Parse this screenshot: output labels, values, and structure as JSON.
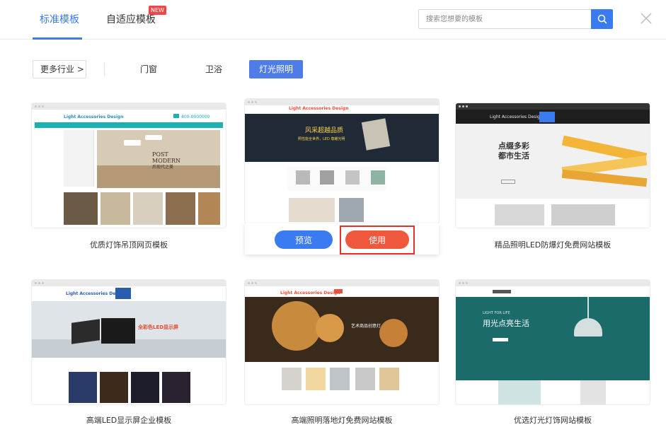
{
  "tabs": {
    "standard": "标准模板",
    "adaptive": "自适应模板",
    "new_badge": "NEW"
  },
  "search": {
    "placeholder": "搜索您想要的模板"
  },
  "filters": {
    "more": "更多行业 >",
    "doors": "门窗",
    "bath": "卫浴",
    "lighting": "灯光照明"
  },
  "cards": [
    {
      "title": "优质灯饰吊顶网页模板",
      "brand": "Light Accessories Design",
      "phone": "400-0000000",
      "headline": "POST MODERN",
      "sub": "后现代之美"
    },
    {
      "title": "",
      "brand": "Light Accessories Design",
      "headline": "风采超越品质",
      "sub": "照性能全世界，LED 尊耀光明",
      "preview": "预览",
      "use": "使用"
    },
    {
      "title": "精品照明LED防爆灯免费网站模板",
      "brand": "Light Accessories Design",
      "headline": "点缀多彩",
      "sub": "都市生活"
    },
    {
      "title": "高端LED显示屏企业模板",
      "brand": "Light Accessories Design",
      "headline": "全彩色LED显示屏"
    },
    {
      "title": "高端照明落地灯免费网站模板",
      "brand": "Light Accessories Design",
      "headline": "艺术商品创意灯"
    },
    {
      "title": "优选灯光灯饰网站模板",
      "headline": "用光点亮生活",
      "sub": "LIGHT FOR LIFE"
    }
  ],
  "colors": {
    "accent": "#3a7bf2",
    "use_button": "#f0583e",
    "highlight_frame": "#e8302a",
    "teal": "#1bb1b1",
    "orange": "#e8503a"
  },
  "icons": {
    "search": "search-icon",
    "close": "close-icon"
  }
}
